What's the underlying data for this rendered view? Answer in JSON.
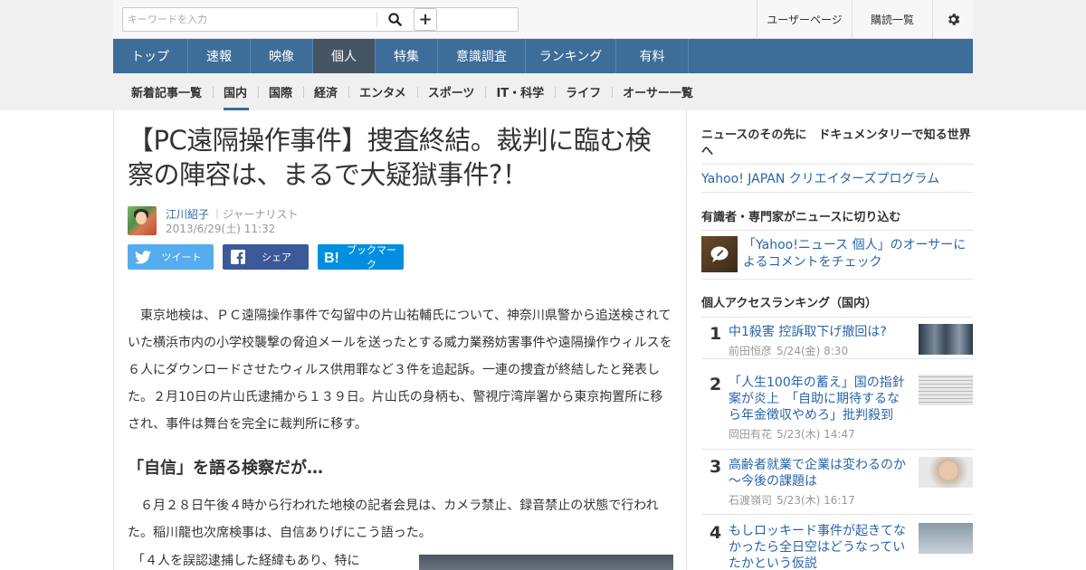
{
  "search": {
    "placeholder": "キーワードを入力",
    "plus": "+"
  },
  "topright": {
    "user_page": "ユーザーページ",
    "subscriptions": "購読一覧"
  },
  "main_nav": [
    {
      "label": "トップ"
    },
    {
      "label": "速報"
    },
    {
      "label": "映像"
    },
    {
      "label": "個人",
      "active": true
    },
    {
      "label": "特集"
    },
    {
      "label": "意識調査"
    },
    {
      "label": "ランキング"
    },
    {
      "label": "有料"
    }
  ],
  "sub_nav": [
    {
      "label": "新着記事一覧"
    },
    {
      "label": "国内",
      "active": true
    },
    {
      "label": "国際"
    },
    {
      "label": "経済"
    },
    {
      "label": "エンタメ"
    },
    {
      "label": "スポーツ"
    },
    {
      "label": "IT・科学"
    },
    {
      "label": "ライフ"
    },
    {
      "label": "オーサー一覧"
    }
  ],
  "article": {
    "title": "【PC遠隔操作事件】捜査終結。裁判に臨む検察の陣容は、まるで大疑獄事件?！",
    "author_name": "江川紹子",
    "author_role": "｜ジャーナリスト",
    "date": "2013/6/29(土) 11:32",
    "share_tweet": "ツイート",
    "share_facebook": "シェア",
    "share_hatena": "ブックマーク",
    "paragraph1": "　東京地検は、ＰＣ遠隔操作事件で勾留中の片山祐輔氏について、神奈川県警から追送検されていた横浜市内の小学校襲撃の脅迫メールを送ったとする威力業務妨害事件や遠隔操作ウィルスを６人にダウンロードさせたウィルス供用罪など３件を追起訴。一連の捜査が終結したと発表した。２月10日の片山氏逮捕から１３９日。片山氏の身柄も、警視庁湾岸署から東京拘置所に移され、事件は舞台を完全に裁判所に移す。",
    "heading2": "「自信」を語る検察だが…",
    "paragraph2": "　６月２８日午後４時から行われた地検の記者会見は、カメラ禁止、録音禁止の状態で行われた。稲川龍也次席検事は、自信ありげにこう語った。",
    "quote": "「４人を誤認逮捕した経緯もあり、特に"
  },
  "sidebar": {
    "doc_heading": "ニュースのその先に　ドキュメンタリーで知る世界へ",
    "creators_link": "Yahoo! JAPAN クリエイターズプログラム",
    "experts_heading": "有識者・専門家がニュースに切り込む",
    "comment_link": "「Yahoo!ニュース 個人」のオーサーによるコメントをチェック",
    "ranking_heading": "個人アクセスランキング（国内）",
    "ranking": [
      {
        "rank": "1",
        "title": "中1殺害 控訴取下げ撤回は?",
        "author": "前田恒彦",
        "date": "5/24(金) 8:30"
      },
      {
        "rank": "2",
        "title": "「人生100年の蓄え」国の指針案が炎上　「自助に期待するなら年金徴収やめろ」批判殺到",
        "author": "岡田有花",
        "date": "5/23(木) 14:47"
      },
      {
        "rank": "3",
        "title": "高齢者就業で企業は変わるのか～今後の課題は",
        "author": "石渡嶺司",
        "date": "5/23(木) 16:17"
      },
      {
        "rank": "4",
        "title": "もしロッキード事件が起きてなかったら全日空はどうなっていたかという仮説",
        "author": "",
        "date": ""
      }
    ]
  },
  "colors": {
    "nav_bg": "#3d6d99",
    "nav_active": "#455563",
    "link": "#2a64a8",
    "twitter": "#55acee",
    "facebook": "#3b5998",
    "hatena": "#008fde"
  }
}
